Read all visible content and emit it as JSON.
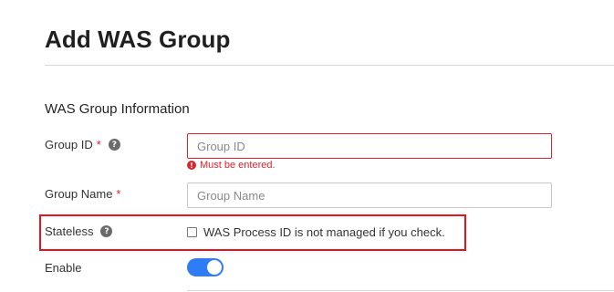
{
  "page_title": "Add WAS Group",
  "section_title": "WAS Group Information",
  "fields": {
    "group_id": {
      "label": "Group ID",
      "required_mark": "*",
      "help_icon": "?",
      "placeholder": "Group ID",
      "value": "",
      "error_icon": "!",
      "error": "Must be entered."
    },
    "group_name": {
      "label": "Group Name",
      "required_mark": "*",
      "placeholder": "Group Name",
      "value": ""
    },
    "stateless": {
      "label": "Stateless",
      "help_icon": "?",
      "checkbox_label": "WAS Process ID is not managed if you check.",
      "checked": false
    },
    "enable": {
      "label": "Enable",
      "on": true
    }
  },
  "colors": {
    "error": "#d9262c",
    "highlight": "#e3141c",
    "toggle_on": "#2e7cf6"
  }
}
